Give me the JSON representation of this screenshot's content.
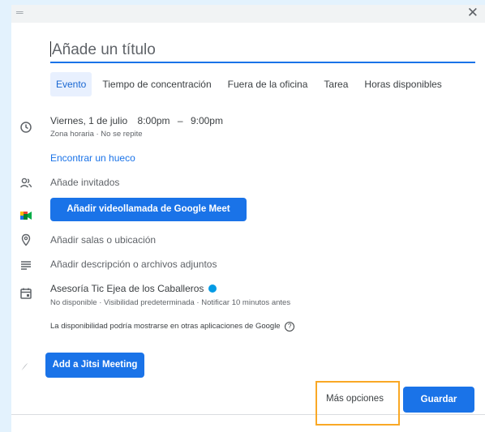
{
  "dialog": {
    "title_placeholder": "Añade un título",
    "close_glyph": "✕"
  },
  "tabs": [
    {
      "label": "Evento",
      "active": true
    },
    {
      "label": "Tiempo de concentración"
    },
    {
      "label": "Fuera de la oficina"
    },
    {
      "label": "Tarea"
    },
    {
      "label": "Horas disponibles"
    }
  ],
  "datetime": {
    "date": "Viernes, 1 de julio",
    "start": "8:00pm",
    "separator": "–",
    "end": "9:00pm",
    "subtext": "Zona horaria · No se repite"
  },
  "find_slot": "Encontrar un hueco",
  "guests": "Añade invitados",
  "meet_button": "Añadir videollamada de Google Meet",
  "location": "Añadir salas o ubicación",
  "description": "Añadir descripción o archivos adjuntos",
  "calendar": {
    "name": "Asesoría Tic Ejea de los Caballeros",
    "color": "#039be5",
    "details": "No disponible · Visibilidad predeterminada · Notificar 10 minutos antes"
  },
  "availability_note": "La disponibilidad podría mostrarse en otras aplicaciones de Google",
  "jitsi_button": "Add a Jitsi Meeting",
  "more_options": "Más opciones",
  "save_button": "Guardar",
  "colors": {
    "accent": "#1a73e8",
    "highlight": "#f9a825",
    "background": "#e3f2fd"
  }
}
